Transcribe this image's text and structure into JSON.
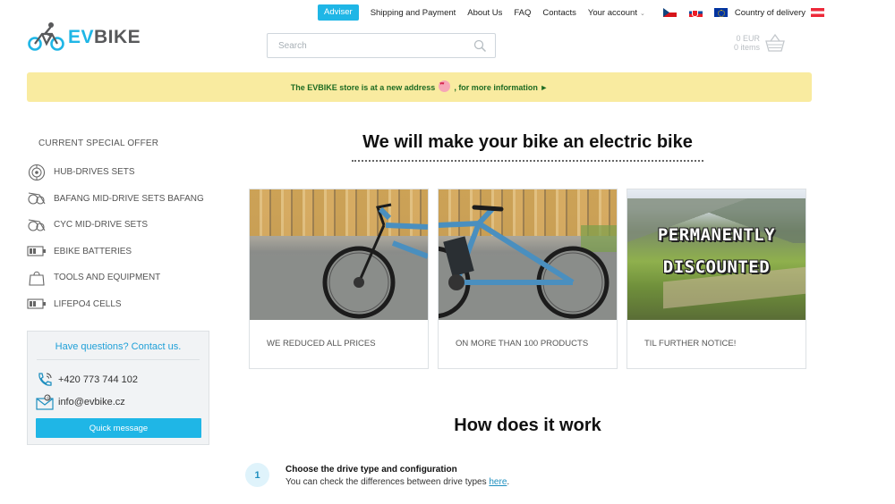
{
  "topbar": {
    "adviser": "Adviser",
    "links": [
      "Shipping and Payment",
      "About Us",
      "FAQ",
      "Contacts"
    ],
    "account": "Your account",
    "delivery": "Country of delivery",
    "flags": [
      "flag-cz-icon",
      "flag-sk-icon",
      "flag-eu-icon",
      "flag-at-icon"
    ]
  },
  "header": {
    "logo_ev": "EV",
    "logo_bike": "BIKE",
    "search_placeholder": "Search",
    "cart_amount": "0 EUR",
    "cart_items": "0 items"
  },
  "notice": {
    "before": "The EVBIKE store is at a new address",
    "after": ", for more information ►",
    "emoji": "heart-eyes-icon"
  },
  "sidebar": {
    "title": "CURRENT SPECIAL OFFER",
    "categories": [
      {
        "label": "HUB-DRIVES SETS",
        "icon": "hub-motor-icon"
      },
      {
        "label": "BAFANG MID-DRIVE SETS BAFANG",
        "icon": "mid-drive-icon"
      },
      {
        "label": "CYC MID-DRIVE SETS",
        "icon": "mid-drive-icon"
      },
      {
        "label": "EBIKE BATTERIES",
        "icon": "battery-icon"
      },
      {
        "label": "TOOLS AND EQUIPMENT",
        "icon": "bag-icon"
      },
      {
        "label": "LIFEPO4 CELLS",
        "icon": "battery-icon"
      }
    ],
    "contact": {
      "title": "Have questions? Contact us.",
      "phone": "+420 773 744 102",
      "email": "info@evbike.cz",
      "button": "Quick message"
    }
  },
  "main": {
    "title": "We will make your bike an electric bike",
    "cards": [
      {
        "label": "WE REDUCED ALL PRICES"
      },
      {
        "label": "ON MORE THAN 100 PRODUCTS"
      },
      {
        "label": "TIL FURTHER NOTICE!",
        "promo_line1": "PERMANENTLY",
        "promo_line2": "DISCOUNTED"
      }
    ],
    "how_title": "How does it work",
    "steps": [
      {
        "number": "1",
        "title": "Choose the drive type and configuration",
        "desc": "You can check the differences between drive types ",
        "link": "here",
        "desc_end": "."
      }
    ]
  },
  "colors": {
    "accent": "#1fb6e6",
    "notice_bg": "#f9eba0",
    "notice_text": "#1e6b22"
  }
}
